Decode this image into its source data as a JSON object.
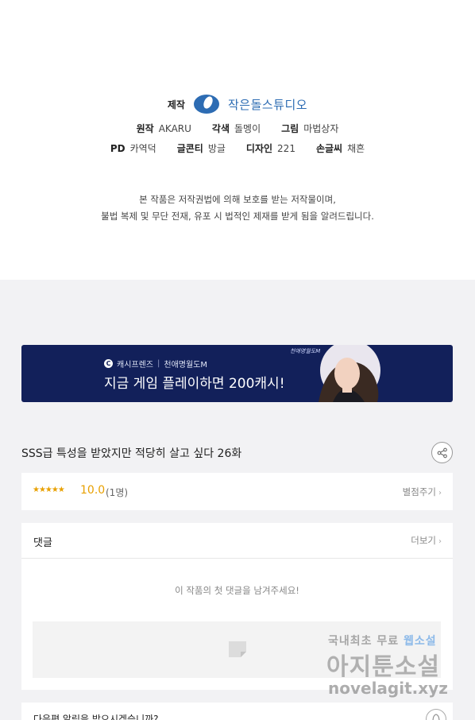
{
  "credits": {
    "production_label": "제작",
    "studio_name": "작은돌스튜디오",
    "original_label": "원작",
    "original_value": "AKARU",
    "adaptation_label": "각색",
    "adaptation_value": "돌멩이",
    "art_label": "그림",
    "art_value": "마법상자",
    "pd_label": "PD",
    "pd_value": "카역덕",
    "continuity_label": "글콘티",
    "continuity_value": "방글",
    "design_label": "디자인",
    "design_value": "221",
    "lettering_label": "손글씨",
    "lettering_value": "채흔"
  },
  "notice": {
    "line1": "본 작품은 저작권법에 의해 보호를 받는 저작물이며,",
    "line2": "불법 복제 및 무단 전재, 유포 시 법적인 제재를 받게 됨을 알려드립니다."
  },
  "banner": {
    "brand": "캐시프렌즈",
    "game": "천애명월도M",
    "headline": "지금 게임 플레이하면 200캐시!",
    "tag": "천애명월도M"
  },
  "episode": {
    "title": "SSS급 특성을 받았지만 적당히 살고 싶다 26화"
  },
  "rating": {
    "stars": "★★★★★",
    "score": "10.0",
    "count": "(1명)",
    "rate_button": "별점주기"
  },
  "comments": {
    "title": "댓글",
    "more_button": "더보기",
    "empty_message": "이 작품의 첫 댓글을 남겨주세요!"
  },
  "next_alert": {
    "text": "다음편 알림을 받으시겠습니까?"
  },
  "watermark": {
    "line1_prefix": "국내최초 무료",
    "line1_highlight": "웹소설",
    "line2": "아지툰소설",
    "line3": "novelagit.xyz"
  },
  "colors": {
    "studio_blue": "#2d6cb3",
    "banner_navy": "#12205a",
    "star_orange": "#e8a000",
    "page_grey": "#f2f2f4"
  }
}
